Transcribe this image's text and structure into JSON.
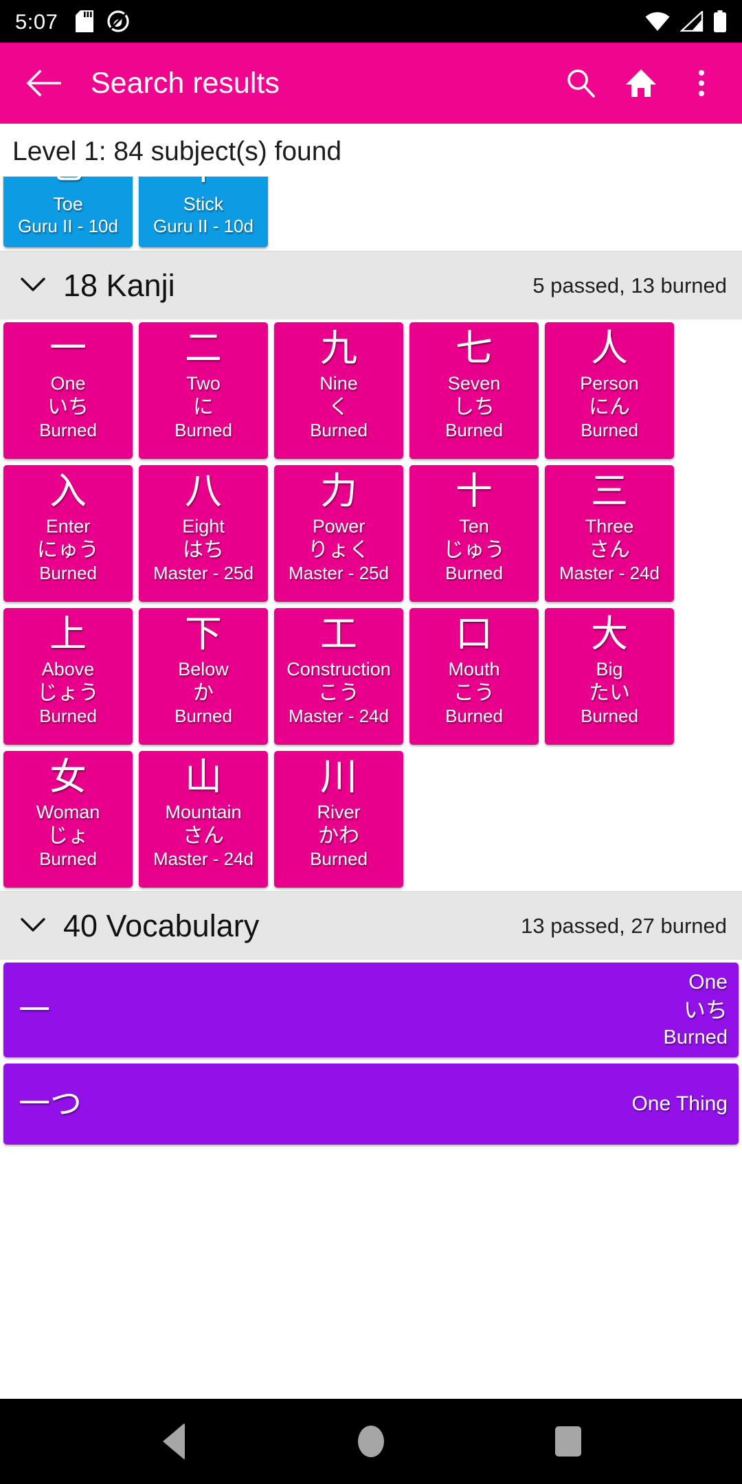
{
  "status_bar": {
    "time": "5:07",
    "left_icons": [
      "sd-card-icon",
      "do-not-disturb-icon"
    ],
    "right_icons": [
      "wifi-icon",
      "cellular-signal-icon",
      "battery-icon"
    ]
  },
  "app_bar": {
    "back_label": "back-arrow",
    "title": "Search results",
    "actions": [
      "search-icon",
      "home-icon",
      "overflow-menu-icon"
    ],
    "background_color": "#F0058F"
  },
  "level_header": "Level 1: 84 subject(s) found",
  "radicals": {
    "color": "#0D9BE3",
    "items": [
      {
        "glyph": "⺃",
        "meaning": "Toe",
        "srs": "Guru II - 10d"
      },
      {
        "glyph": "丨",
        "meaning": "Stick",
        "srs": "Guru II - 10d"
      }
    ]
  },
  "kanji_section": {
    "chevron": "chevron-down-icon",
    "title": "18 Kanji",
    "stats": "5 passed, 13 burned",
    "color": "#E8008C",
    "items": [
      {
        "glyph": "一",
        "meaning": "One",
        "reading": "いち",
        "srs": "Burned"
      },
      {
        "glyph": "二",
        "meaning": "Two",
        "reading": "に",
        "srs": "Burned"
      },
      {
        "glyph": "九",
        "meaning": "Nine",
        "reading": "く",
        "srs": "Burned"
      },
      {
        "glyph": "七",
        "meaning": "Seven",
        "reading": "しち",
        "srs": "Burned"
      },
      {
        "glyph": "人",
        "meaning": "Person",
        "reading": "にん",
        "srs": "Burned"
      },
      {
        "glyph": "入",
        "meaning": "Enter",
        "reading": "にゅう",
        "srs": "Burned"
      },
      {
        "glyph": "八",
        "meaning": "Eight",
        "reading": "はち",
        "srs": "Master - 25d"
      },
      {
        "glyph": "力",
        "meaning": "Power",
        "reading": "りょく",
        "srs": "Master - 25d"
      },
      {
        "glyph": "十",
        "meaning": "Ten",
        "reading": "じゅう",
        "srs": "Burned"
      },
      {
        "glyph": "三",
        "meaning": "Three",
        "reading": "さん",
        "srs": "Master - 24d"
      },
      {
        "glyph": "上",
        "meaning": "Above",
        "reading": "じょう",
        "srs": "Burned"
      },
      {
        "glyph": "下",
        "meaning": "Below",
        "reading": "か",
        "srs": "Burned"
      },
      {
        "glyph": "工",
        "meaning": "Construction",
        "reading": "こう",
        "srs": "Master - 24d"
      },
      {
        "glyph": "口",
        "meaning": "Mouth",
        "reading": "こう",
        "srs": "Burned"
      },
      {
        "glyph": "大",
        "meaning": "Big",
        "reading": "たい",
        "srs": "Burned"
      },
      {
        "glyph": "女",
        "meaning": "Woman",
        "reading": "じょ",
        "srs": "Burned"
      },
      {
        "glyph": "山",
        "meaning": "Mountain",
        "reading": "さん",
        "srs": "Master - 24d"
      },
      {
        "glyph": "川",
        "meaning": "River",
        "reading": "かわ",
        "srs": "Burned"
      }
    ]
  },
  "vocabulary_section": {
    "chevron": "chevron-down-icon",
    "title": "40 Vocabulary",
    "stats": "13 passed, 27 burned",
    "color": "#9211E8",
    "items": [
      {
        "glyph": "一",
        "meaning": "One",
        "reading": "いち",
        "srs": "Burned"
      },
      {
        "glyph": "一つ",
        "meaning": "One Thing",
        "reading": "",
        "srs": ""
      }
    ]
  },
  "nav_bar": {
    "buttons": [
      "back-nav-button",
      "home-nav-button",
      "recents-nav-button"
    ]
  }
}
